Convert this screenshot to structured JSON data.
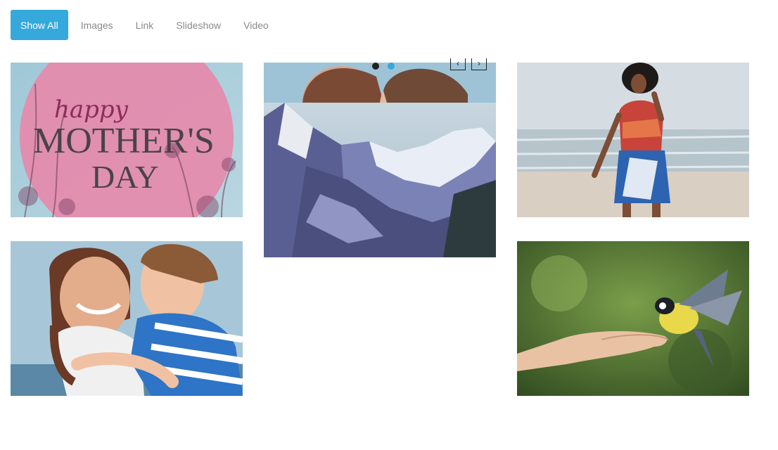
{
  "filters": [
    {
      "label": "Show All",
      "active": true
    },
    {
      "label": "Images",
      "active": false
    },
    {
      "label": "Link",
      "active": false
    },
    {
      "label": "Slideshow",
      "active": false
    },
    {
      "label": "Video",
      "active": false
    }
  ],
  "mothers_day": {
    "line1": "happy",
    "line2": "MOTHER'S",
    "line3": "DAY"
  },
  "slideshow": {
    "prev_glyph": "‹",
    "next_glyph": "›",
    "dots": 2,
    "active_dot": 1
  },
  "colors": {
    "accent": "#35a9dc",
    "filter_text": "#8a8a8a"
  }
}
